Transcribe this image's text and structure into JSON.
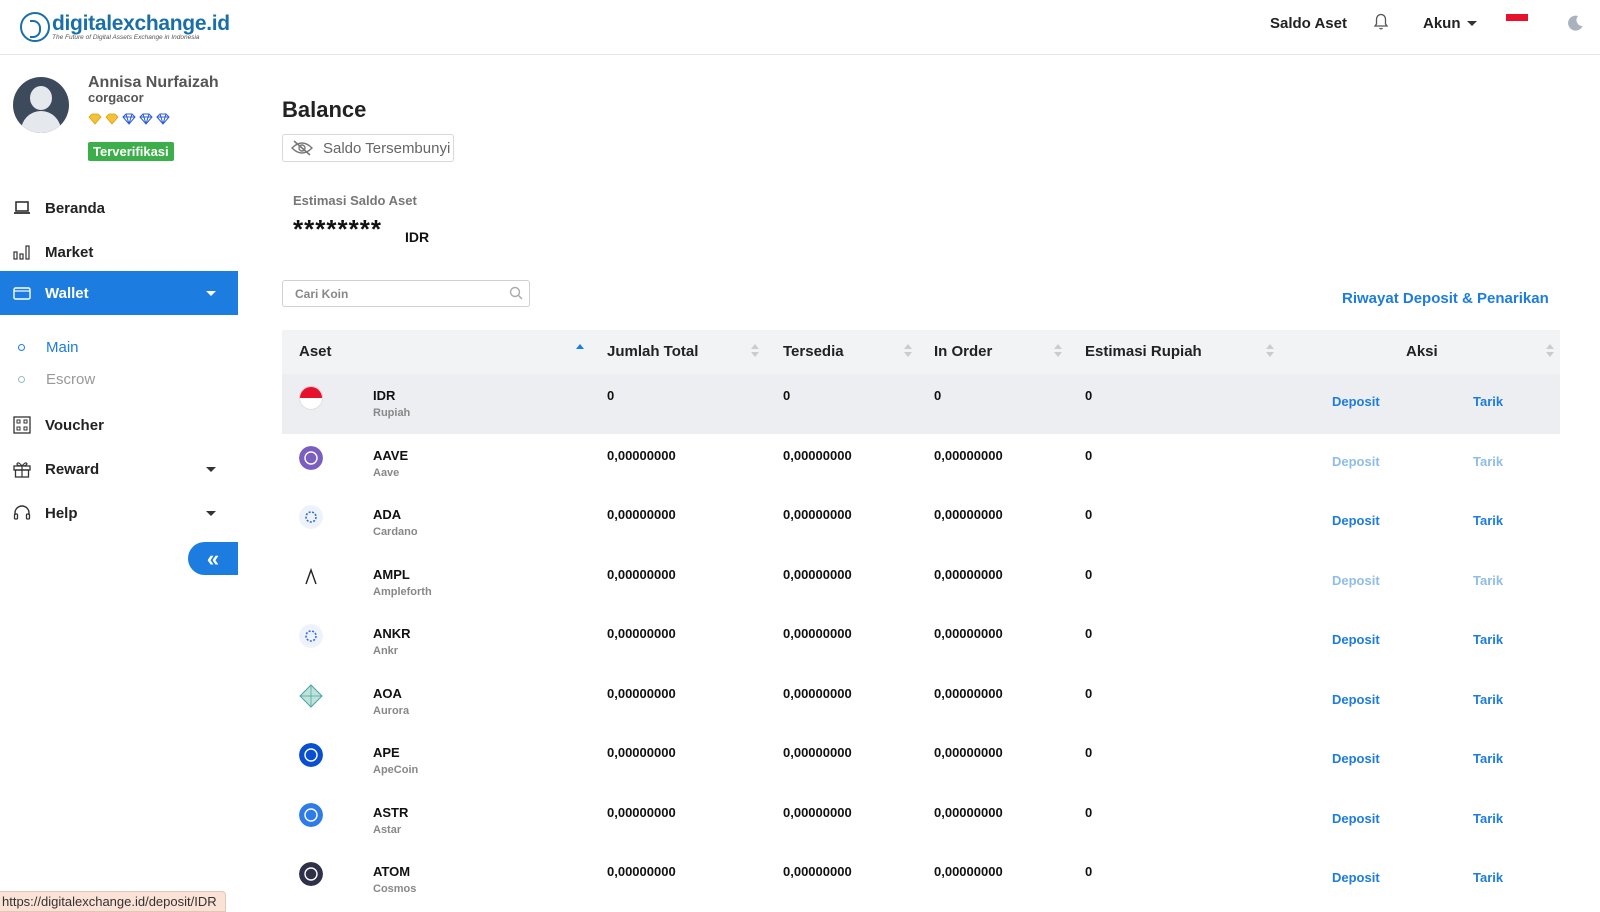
{
  "header": {
    "logo_name": "digitalexchange.id",
    "logo_tagline": "The Future of Digital Assets Exchange in Indonesia",
    "saldo_label": "Saldo Aset",
    "akun_label": "Akun"
  },
  "profile": {
    "name": "Annisa Nurfaizah",
    "handle": "corgacor",
    "verified_label": "Terverifikasi"
  },
  "sidebar": {
    "items": [
      {
        "label": "Beranda"
      },
      {
        "label": "Market"
      },
      {
        "label": "Wallet"
      },
      {
        "label": "Voucher"
      },
      {
        "label": "Reward"
      },
      {
        "label": "Help"
      }
    ],
    "wallet_sub": [
      {
        "label": "Main"
      },
      {
        "label": "Escrow"
      }
    ]
  },
  "main": {
    "title": "Balance",
    "hide_balance_label": "Saldo Tersembunyi",
    "estimate_label": "Estimasi Saldo Aset",
    "estimate_value": "********",
    "estimate_currency": "IDR",
    "search_placeholder": "Cari Koin",
    "history_link": "Riwayat Deposit & Penarikan"
  },
  "table": {
    "headers": [
      "Aset",
      "Jumlah Total",
      "Tersedia",
      "In Order",
      "Estimasi Rupiah",
      "Aksi"
    ],
    "deposit_label": "Deposit",
    "withdraw_label": "Tarik",
    "rows": [
      {
        "symbol": "IDR",
        "name": "Rupiah",
        "total": "0",
        "available": "0",
        "in_order": "0",
        "estimate": "0",
        "icon": "idr-flag-icon",
        "color": "#e8112d"
      },
      {
        "symbol": "AAVE",
        "name": "Aave",
        "total": "0,00000000",
        "available": "0,00000000",
        "in_order": "0,00000000",
        "estimate": "0",
        "icon": "aave-coin-icon",
        "color": "#7a5fc0"
      },
      {
        "symbol": "ADA",
        "name": "Cardano",
        "total": "0,00000000",
        "available": "0,00000000",
        "in_order": "0,00000000",
        "estimate": "0",
        "icon": "cardano-coin-icon",
        "color": "#2a71d0"
      },
      {
        "symbol": "AMPL",
        "name": "Ampleforth",
        "total": "0,00000000",
        "available": "0,00000000",
        "in_order": "0,00000000",
        "estimate": "0",
        "icon": "ampleforth-coin-icon",
        "color": "#222222"
      },
      {
        "symbol": "ANKR",
        "name": "Ankr",
        "total": "0,00000000",
        "available": "0,00000000",
        "in_order": "0,00000000",
        "estimate": "0",
        "icon": "ankr-coin-icon",
        "color": "#2e6bf6"
      },
      {
        "symbol": "AOA",
        "name": "Aurora",
        "total": "0,00000000",
        "available": "0,00000000",
        "in_order": "0,00000000",
        "estimate": "0",
        "icon": "aurora-coin-icon",
        "color": "#4aa3a0"
      },
      {
        "symbol": "APE",
        "name": "ApeCoin",
        "total": "0,00000000",
        "available": "0,00000000",
        "in_order": "0,00000000",
        "estimate": "0",
        "icon": "apecoin-coin-icon",
        "color": "#0b4fd1"
      },
      {
        "symbol": "ASTR",
        "name": "Astar",
        "total": "0,00000000",
        "available": "0,00000000",
        "in_order": "0,00000000",
        "estimate": "0",
        "icon": "astar-coin-icon",
        "color": "#2f7ce8"
      },
      {
        "symbol": "ATOM",
        "name": "Cosmos",
        "total": "0,00000000",
        "available": "0,00000000",
        "in_order": "0,00000000",
        "estimate": "0",
        "icon": "cosmos-coin-icon",
        "color": "#2e3148"
      }
    ]
  },
  "status_url": "https://digitalexchange.id/deposit/IDR",
  "colors": {
    "accent": "#1c7cdf",
    "verified": "#3cae4a"
  }
}
